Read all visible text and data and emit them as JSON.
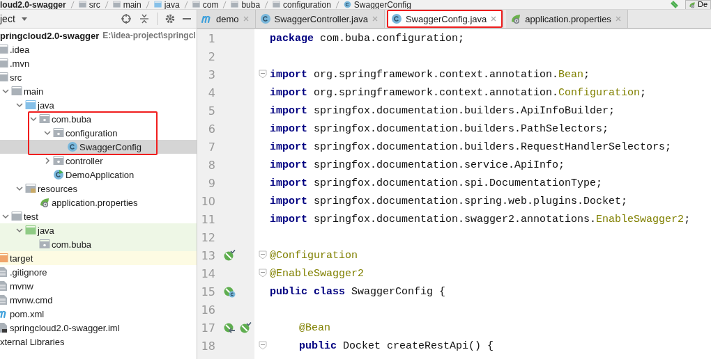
{
  "breadcrumb": [
    "loud2.0-swagger",
    "src",
    "main",
    "java",
    "com",
    "buba",
    "configuration",
    "SwaggerConfig"
  ],
  "run_config": "De",
  "project": {
    "title": "ject",
    "tree": [
      {
        "label": "pringcloud2.0-swagger",
        "path": "E:\\idea-project\\springcl",
        "kind": "root",
        "selected": false,
        "children": [
          {
            "label": ".idea",
            "kind": "folder",
            "selected": false
          },
          {
            "label": ".mvn",
            "kind": "folder",
            "selected": false
          },
          {
            "label": "src",
            "kind": "folder",
            "selected": false,
            "children": [
              {
                "label": "main",
                "kind": "folder",
                "expanded": true,
                "selected": false,
                "children": [
                  {
                    "label": "java",
                    "kind": "source-folder",
                    "expanded": true,
                    "selected": false,
                    "children": [
                      {
                        "label": "com.buba",
                        "kind": "package",
                        "expanded": true,
                        "callout": true,
                        "selected": false,
                        "children": [
                          {
                            "label": "configuration",
                            "kind": "package",
                            "expanded": true,
                            "selected": false,
                            "children": [
                              {
                                "label": "SwaggerConfig",
                                "kind": "class",
                                "selected": true
                              }
                            ]
                          },
                          {
                            "label": "controller",
                            "kind": "package",
                            "expanded": false,
                            "selected": false
                          },
                          {
                            "label": "DemoApplication",
                            "kind": "spring-class",
                            "selected": false
                          }
                        ]
                      }
                    ]
                  },
                  {
                    "label": "resources",
                    "kind": "resource-folder",
                    "expanded": true,
                    "selected": false,
                    "children": [
                      {
                        "label": "application.properties",
                        "kind": "properties",
                        "selected": false
                      }
                    ]
                  }
                ]
              },
              {
                "label": "test",
                "kind": "folder",
                "expanded": true,
                "selected": false,
                "children": [
                  {
                    "label": "java",
                    "kind": "test-folder",
                    "expanded": true,
                    "selected": false,
                    "children": [
                      {
                        "label": "com.buba",
                        "kind": "test-package",
                        "selected": false
                      }
                    ]
                  }
                ]
              }
            ]
          },
          {
            "label": "target",
            "kind": "excluded-folder",
            "selected": false
          },
          {
            "label": ".gitignore",
            "kind": "file",
            "selected": false
          },
          {
            "label": "mvnw",
            "kind": "file",
            "selected": false
          },
          {
            "label": "mvnw.cmd",
            "kind": "file",
            "selected": false
          },
          {
            "label": "pom.xml",
            "kind": "maven",
            "selected": false
          },
          {
            "label": "springcloud2.0-swagger.iml",
            "kind": "iml",
            "selected": false
          }
        ]
      },
      {
        "label": "xternal Libraries",
        "kind": "root",
        "selected": false
      }
    ]
  },
  "tabs": [
    {
      "label": "demo",
      "kind": "maven",
      "selected": false,
      "callout": false
    },
    {
      "label": "SwaggerController.java",
      "kind": "class",
      "selected": false,
      "callout": false
    },
    {
      "label": "SwaggerConfig.java",
      "kind": "class",
      "selected": true,
      "callout": true
    },
    {
      "label": "application.properties",
      "kind": "properties",
      "selected": false,
      "callout": false
    }
  ],
  "editor": {
    "lines": [
      {
        "number": "1",
        "fold": false,
        "code": [
          {
            "t": "package",
            "kind": "keyword"
          },
          {
            "t": " com.buba.configuration;",
            "kind": "plain"
          }
        ]
      },
      {
        "number": "2",
        "fold": false
      },
      {
        "number": "3",
        "fold": true,
        "code": [
          {
            "t": "import",
            "kind": "keyword"
          },
          {
            "t": " org.springframework.context.annotation.",
            "kind": "plain"
          },
          {
            "t": "Bean",
            "kind": "annotation"
          },
          {
            "t": ";",
            "kind": "plain"
          }
        ]
      },
      {
        "number": "4",
        "fold": false,
        "code": [
          {
            "t": "import",
            "kind": "keyword"
          },
          {
            "t": " org.springframework.context.annotation.",
            "kind": "plain"
          },
          {
            "t": "Configuration",
            "kind": "annotation"
          },
          {
            "t": ";",
            "kind": "plain"
          }
        ]
      },
      {
        "number": "5",
        "fold": false,
        "code": [
          {
            "t": "import",
            "kind": "keyword"
          },
          {
            "t": " springfox.documentation.builders.ApiInfoBuilder;",
            "kind": "plain"
          }
        ]
      },
      {
        "number": "6",
        "fold": false,
        "code": [
          {
            "t": "import",
            "kind": "keyword"
          },
          {
            "t": " springfox.documentation.builders.PathSelectors;",
            "kind": "plain"
          }
        ]
      },
      {
        "number": "7",
        "fold": false,
        "code": [
          {
            "t": "import",
            "kind": "keyword"
          },
          {
            "t": " springfox.documentation.builders.RequestHandlerSelectors;",
            "kind": "plain"
          }
        ]
      },
      {
        "number": "8",
        "fold": false,
        "code": [
          {
            "t": "import",
            "kind": "keyword"
          },
          {
            "t": " springfox.documentation.service.ApiInfo;",
            "kind": "plain"
          }
        ]
      },
      {
        "number": "9",
        "fold": false,
        "code": [
          {
            "t": "import",
            "kind": "keyword"
          },
          {
            "t": " springfox.documentation.spi.DocumentationType;",
            "kind": "plain"
          }
        ]
      },
      {
        "number": "10",
        "fold": false,
        "code": [
          {
            "t": "import",
            "kind": "keyword"
          },
          {
            "t": " springfox.documentation.spring.web.plugins.Docket;",
            "kind": "plain"
          }
        ]
      },
      {
        "number": "11",
        "fold": false,
        "code": [
          {
            "t": "import",
            "kind": "keyword"
          },
          {
            "t": " springfox.documentation.swagger2.annotations.",
            "kind": "plain"
          },
          {
            "t": "EnableSwagger2",
            "kind": "annotation"
          },
          {
            "t": ";",
            "kind": "plain"
          }
        ]
      },
      {
        "number": "12",
        "fold": false
      },
      {
        "number": "13",
        "fold": true,
        "gutter": [
          {
            "kind": "bean-check"
          }
        ],
        "code": [
          {
            "t": "@Configuration",
            "kind": "annotation"
          }
        ]
      },
      {
        "number": "14",
        "fold": true,
        "code": [
          {
            "t": "@EnableSwagger2",
            "kind": "annotation"
          }
        ]
      },
      {
        "number": "15",
        "fold": false,
        "gutter": [
          {
            "kind": "bean-class"
          }
        ],
        "code": [
          {
            "t": "public class",
            "kind": "keyword"
          },
          {
            "t": " SwaggerConfig {",
            "kind": "plain"
          }
        ]
      },
      {
        "number": "16",
        "fold": false
      },
      {
        "number": "17",
        "fold": false,
        "indented": true,
        "gutter": [
          {
            "kind": "bean-arrow"
          },
          {
            "kind": "bean-check"
          }
        ],
        "code": [
          {
            "t": "@Bean",
            "kind": "annotation"
          }
        ]
      },
      {
        "number": "18",
        "fold": true,
        "indented": true,
        "code": [
          {
            "t": "public",
            "kind": "keyword"
          },
          {
            "t": " Docket createRestApi() {",
            "kind": "plain"
          }
        ]
      }
    ]
  }
}
